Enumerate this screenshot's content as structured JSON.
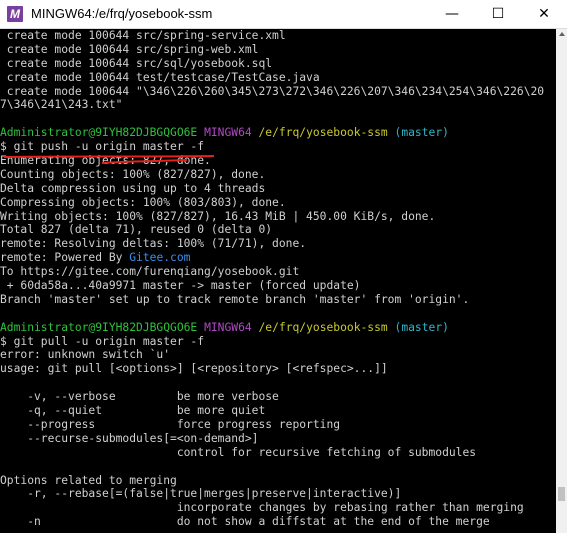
{
  "window": {
    "icon_letter": "M",
    "title": "MINGW64:/e/frq/yosebook-ssm",
    "minimize": "—",
    "maximize": "☐",
    "close": "✕"
  },
  "colors": {
    "background": "#000000",
    "text": "#d0d0d0",
    "prompt_user": "#2fc13b",
    "prompt_host": "#b148c6",
    "prompt_path": "#c9c930",
    "prompt_branch": "#32b5c8",
    "annotation": "#e0231c"
  },
  "terminal": {
    "l0": " create mode 100644 src/spring-service.xml",
    "l1": " create mode 100644 src/spring-web.xml",
    "l2": " create mode 100644 src/sql/yosebook.sql",
    "l3": " create mode 100644 test/testcase/TestCase.java",
    "l4": " create mode 100644 \"\\346\\226\\260\\345\\273\\272\\346\\226\\207\\346\\234\\254\\346\\226\\20",
    "l5": "7\\346\\241\\243.txt\"",
    "l6": "",
    "p1_user": "Administrator@9IYH82DJBGQGO6E",
    "p1_host": "MINGW64",
    "p1_path": "/e/frq/yosebook-ssm",
    "p1_branch": "(master)",
    "cmd1": "$ git push -u origin master -f",
    "l9": "Enumerating objects: 827, done.",
    "l10": "Counting objects: 100% (827/827), done.",
    "l11": "Delta compression using up to 4 threads",
    "l12": "Compressing objects: 100% (803/803), done.",
    "l13": "Writing objects: 100% (827/827), 16.43 MiB | 450.00 KiB/s, done.",
    "l14": "Total 827 (delta 71), reused 0 (delta 0)",
    "l15": "remote: Resolving deltas: 100% (71/71), done.",
    "l16_pre": "remote: Powered By ",
    "l16_link": "Gitee.com",
    "l17": "To https://gitee.com/furenqiang/yosebook.git",
    "l18": " + 60da58a...40a9971 master -> master (forced update)",
    "l19": "Branch 'master' set up to track remote branch 'master' from 'origin'.",
    "l20": "",
    "p2_user": "Administrator@9IYH82DJBGQGO6E",
    "p2_host": "MINGW64",
    "p2_path": "/e/frq/yosebook-ssm",
    "p2_branch": "(master)",
    "cmd2": "$ git pull -u origin master -f",
    "l23": "error: unknown switch `u'",
    "l24": "usage: git pull [<options>] [<repository> [<refspec>...]]",
    "l25": "",
    "l26": "    -v, --verbose         be more verbose",
    "l27": "    -q, --quiet           be more quiet",
    "l28": "    --progress            force progress reporting",
    "l29": "    --recurse-submodules[=<on-demand>]",
    "l30": "                          control for recursive fetching of submodules",
    "l31": "",
    "l32": "Options related to merging",
    "l33": "    -r, --rebase[=(false|true|merges|preserve|interactive)]",
    "l34": "                          incorporate changes by rebasing rather than merging",
    "l35": "    -n                    do not show a diffstat at the end of the merge"
  }
}
